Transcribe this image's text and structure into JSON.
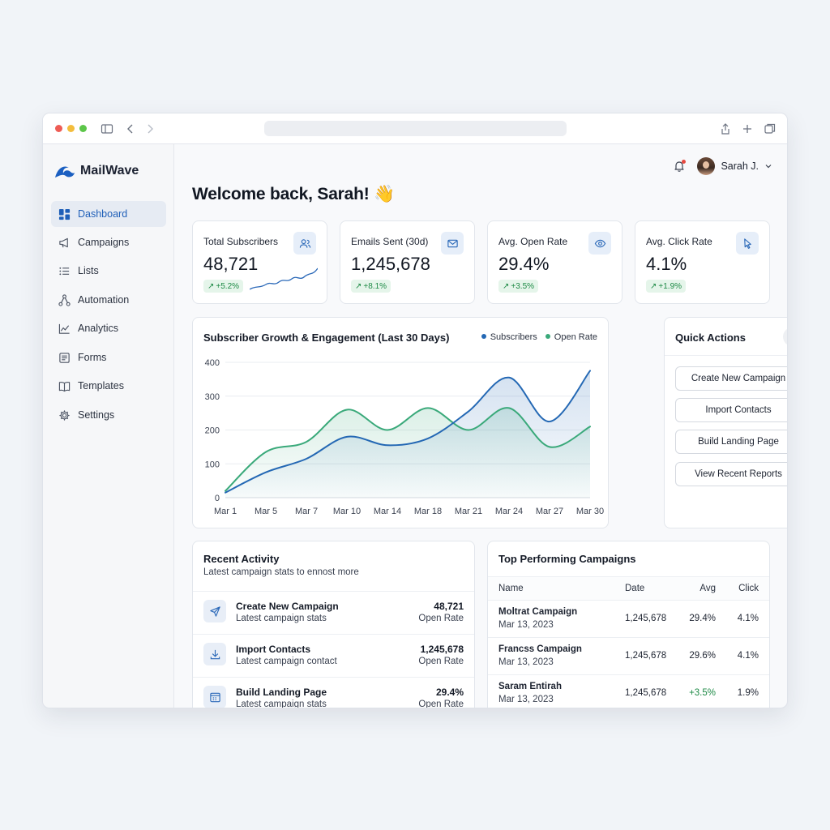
{
  "app": {
    "name": "MailWave"
  },
  "user": {
    "name": "Sarah J."
  },
  "welcome": "Welcome back, Sarah! 👋",
  "sidebar": {
    "items": [
      {
        "label": "Dashboard",
        "icon": "grid-icon",
        "active": true
      },
      {
        "label": "Campaigns",
        "icon": "megaphone-icon"
      },
      {
        "label": "Lists",
        "icon": "list-icon"
      },
      {
        "label": "Automation",
        "icon": "flow-icon"
      },
      {
        "label": "Analytics",
        "icon": "chart-icon"
      },
      {
        "label": "Forms",
        "icon": "form-icon"
      },
      {
        "label": "Templates",
        "icon": "book-icon"
      },
      {
        "label": "Settings",
        "icon": "gear-icon"
      }
    ]
  },
  "stats": [
    {
      "label": "Total Subscribers",
      "value": "48,721",
      "change": "+5.2%",
      "icon": "users-icon"
    },
    {
      "label": "Emails Sent (30d)",
      "value": "1,245,678",
      "change": "+8.1%",
      "icon": "mail-icon"
    },
    {
      "label": "Avg. Open Rate",
      "value": "29.4%",
      "change": "+3.5%",
      "icon": "eye-icon"
    },
    {
      "label": "Avg. Click Rate",
      "value": "4.1%",
      "change": "+1.9%",
      "icon": "cursor-icon"
    }
  ],
  "chart": {
    "title": "Subscriber Growth & Engagement (Last 30 Days)"
  },
  "chart_data": {
    "type": "area",
    "title": "Subscriber Growth & Engagement (Last 30 Days)",
    "categories": [
      "Mar 1",
      "Mar 5",
      "Mar 7",
      "Mar 10",
      "Mar 14",
      "Mar 18",
      "Mar 21",
      "Mar 24",
      "Mar 27",
      "Mar 30"
    ],
    "series": [
      {
        "name": "Subscribers",
        "color": "#2468b4",
        "values": [
          15,
          75,
          115,
          180,
          155,
          175,
          255,
          355,
          225,
          375
        ]
      },
      {
        "name": "Open Rate",
        "color": "#3aa97a",
        "values": [
          20,
          135,
          165,
          260,
          200,
          265,
          200,
          265,
          150,
          210
        ]
      }
    ],
    "yticks": [
      0,
      100,
      200,
      300,
      400
    ],
    "ylim": [
      0,
      400
    ],
    "grid": true,
    "legend": "top-right"
  },
  "quick_actions": {
    "title": "Quick Actions",
    "buttons": [
      "Create New Campaign",
      "Import Contacts",
      "Build Landing Page",
      "View Recent Reports"
    ]
  },
  "activity": {
    "title": "Recent Activity",
    "subtitle": "Latest campaign stats to ennost more",
    "rows": [
      {
        "title": "Create New Campaign",
        "sub": "Latest campaign stats",
        "value": "48,721",
        "value_sub": "Open Rate",
        "icon": "send-icon"
      },
      {
        "title": "Import Contacts",
        "sub": "Latest campaign contact",
        "value": "1,245,678",
        "value_sub": "Open Rate",
        "icon": "download-icon"
      },
      {
        "title": "Build Landing Page",
        "sub": "Latest campaign stats",
        "value": "29.4%",
        "value_sub": "Open Rate",
        "icon": "layout-icon"
      }
    ]
  },
  "top_campaigns": {
    "title": "Top Performing Campaigns",
    "headers": [
      "Name",
      "Date",
      "Avg",
      "Click"
    ],
    "rows": [
      {
        "name": "Moltrat Campaign",
        "date_sub": "Mar 13, 2023",
        "sent": "1,245,678",
        "avg": "29.4%",
        "click": "4.1%"
      },
      {
        "name": "Francss Campaign",
        "date_sub": "Mar 13, 2023",
        "sent": "1,245,678",
        "avg": "29.6%",
        "click": "4.1%"
      },
      {
        "name": "Saram Entirah",
        "date_sub": "Mar 13, 2023",
        "sent": "1,245,678",
        "avg": "+3.5%",
        "click": "1.9%"
      }
    ]
  }
}
